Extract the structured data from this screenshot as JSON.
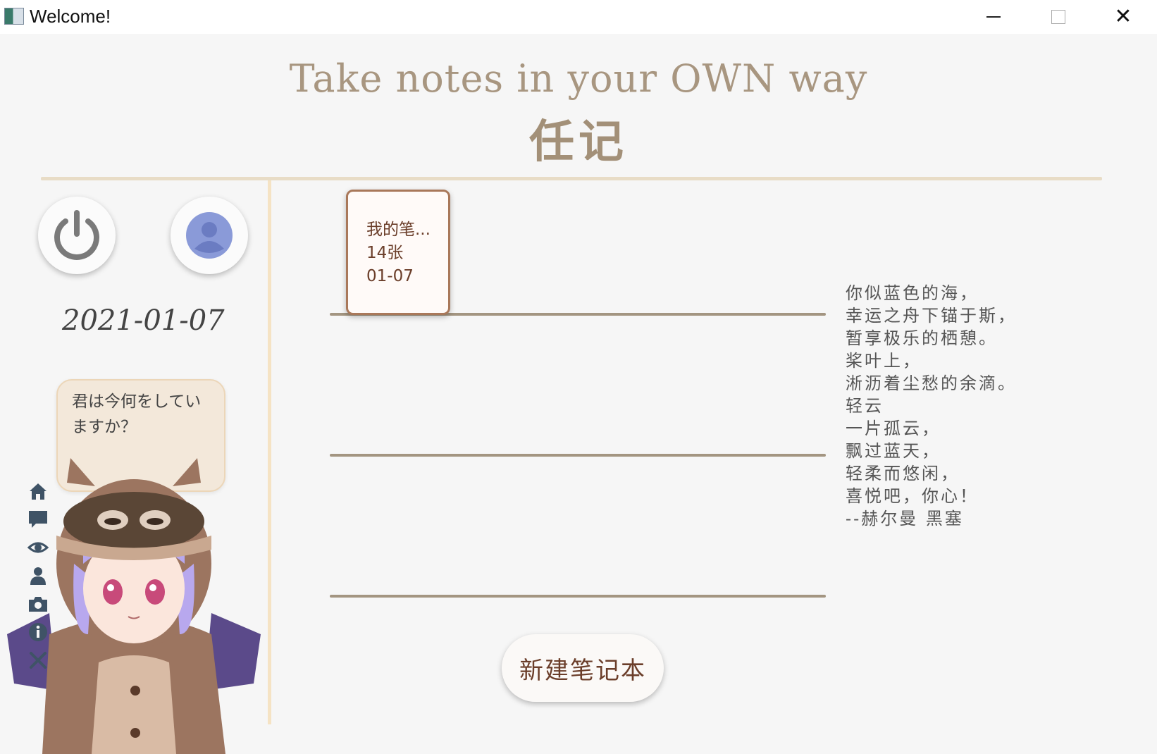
{
  "window": {
    "title": "Welcome!",
    "minimize_glyph": "",
    "close_glyph": "✕"
  },
  "header": {
    "headline": "Take notes in your OWN way",
    "app_name": "任记"
  },
  "sidebar": {
    "date": "2021-01-07",
    "bubble_line1": "君は今何をしてい",
    "bubble_line2": "ますか？",
    "icons": [
      "home-icon",
      "chat-icon",
      "eye-icon",
      "person-icon",
      "camera-icon",
      "info-icon",
      "close-icon"
    ]
  },
  "notebooks": [
    {
      "name": "我的笔...",
      "count": "14张",
      "date": "01-07"
    }
  ],
  "new_notebook_button": "新建笔记本",
  "poem": [
    "你似蓝色的海，",
    "幸运之舟下锚于斯，",
    "暂享极乐的栖憩。",
    "桨叶上，",
    "淅沥着尘愁的余滴。",
    "轻云",
    "一片孤云，",
    "飘过蓝天，",
    "轻柔而悠闲，",
    "喜悦吧，你心！",
    "--赫尔曼 黑塞"
  ],
  "colors": {
    "accent_brown": "#6b3e2a",
    "rule": "#e8dcc6",
    "user_avatar": "#8a9ad8",
    "power_icon": "#7a7a7a",
    "side_icons": "#3f5366"
  }
}
